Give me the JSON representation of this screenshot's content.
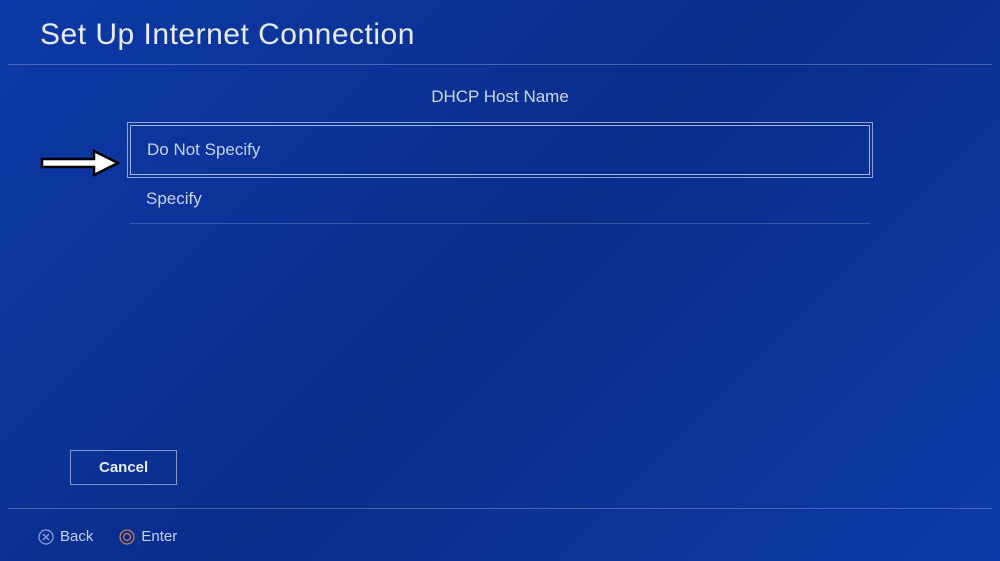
{
  "page_title": "Set Up Internet Connection",
  "section_title": "DHCP Host Name",
  "options": [
    {
      "label": "Do Not Specify",
      "selected": true
    },
    {
      "label": "Specify",
      "selected": false
    }
  ],
  "cancel_label": "Cancel",
  "footer": {
    "back_label": "Back",
    "enter_label": "Enter"
  }
}
